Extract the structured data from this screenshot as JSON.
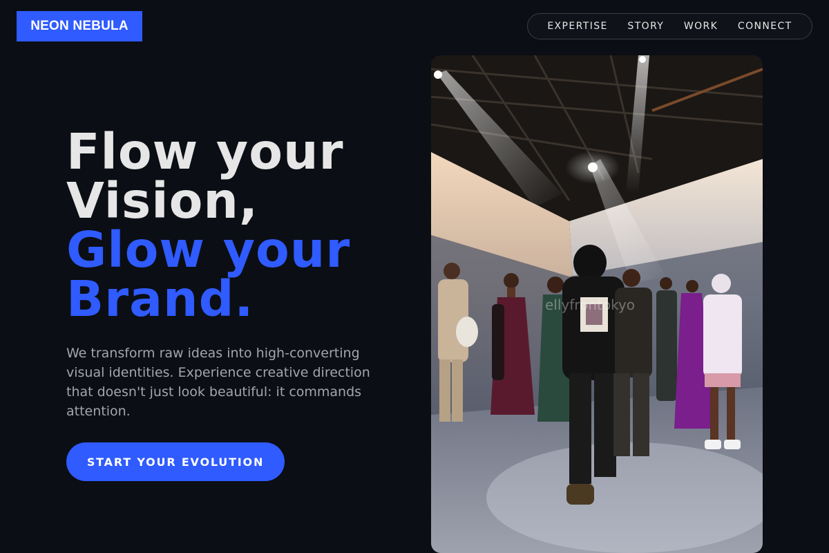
{
  "brand": {
    "logo_text": "NEON NEBULA"
  },
  "nav": {
    "items": [
      {
        "label": "EXPERTISE"
      },
      {
        "label": "STORY"
      },
      {
        "label": "WORK"
      },
      {
        "label": "CONNECT"
      }
    ]
  },
  "hero": {
    "headline": {
      "line1": "Flow your",
      "line2": "Vision,",
      "line3": "Glow your",
      "line4": "Brand."
    },
    "description": "We transform raw ideas into high-converting visual identities. Experience creative direction that doesn't just look beautiful: it commands attention.",
    "cta_label": "START YOUR EVOLUTION",
    "photo_watermark": "ellyfrontokyo"
  },
  "colors": {
    "background": "#0b0e14",
    "accent": "#2f5bff",
    "text_primary": "#e6e6e6",
    "text_secondary": "#a3a6ad"
  }
}
